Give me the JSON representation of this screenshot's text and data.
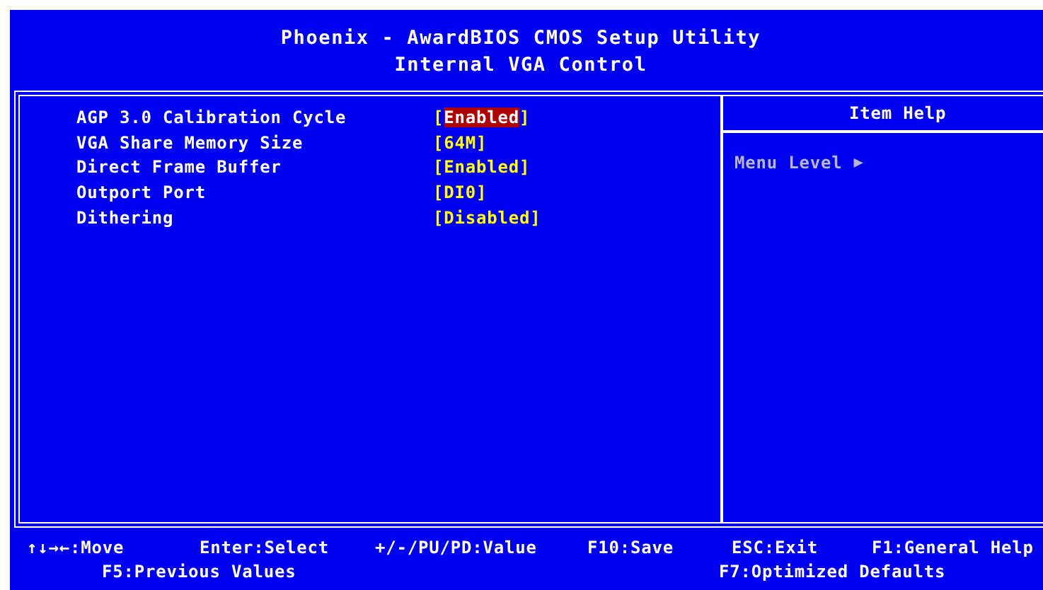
{
  "header": {
    "title": "Phoenix - AwardBIOS CMOS Setup Utility",
    "subtitle": "Internal VGA Control"
  },
  "settings": [
    {
      "label": "AGP 3.0 Calibration Cycle",
      "value": "[Enabled]",
      "selected": true
    },
    {
      "label": "VGA Share Memory Size",
      "value": "[64M]",
      "selected": false
    },
    {
      "label": "Direct Frame Buffer",
      "value": "[Enabled]",
      "selected": false
    },
    {
      "label": "Outport Port",
      "value": "[DI0]",
      "selected": false
    },
    {
      "label": "Dithering",
      "value": "[Disabled]",
      "selected": false
    }
  ],
  "item_help": {
    "title": "Item Help",
    "menu_level": "Menu Level",
    "menu_level_arrow": "▶"
  },
  "footer": {
    "row_1": [
      "↑↓→←:Move",
      "Enter:Select",
      "+/-/PU/PD:Value",
      "F10:Save",
      "ESC:Exit",
      "F1:General Help"
    ],
    "row_2": [
      "F5:Previous Values",
      "F7:Optimized Defaults"
    ]
  }
}
